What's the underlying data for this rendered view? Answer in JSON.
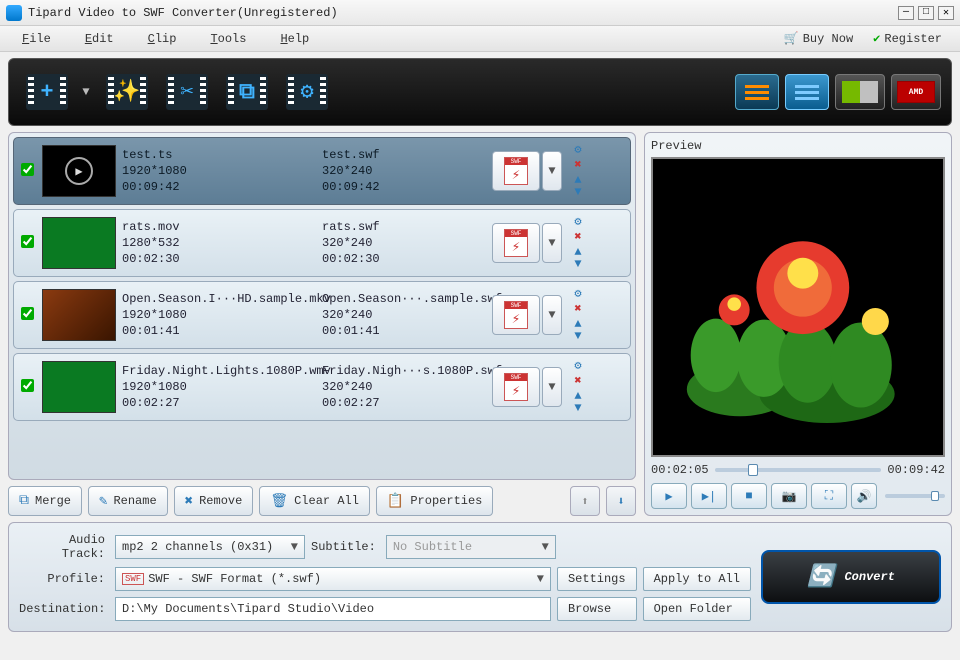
{
  "window": {
    "title": "Tipard Video to SWF Converter(Unregistered)"
  },
  "menu": {
    "file": "File",
    "edit": "Edit",
    "clip": "Clip",
    "tools": "Tools",
    "help": "Help",
    "buy": "Buy Now",
    "register": "Register"
  },
  "toolbar_icons": {
    "add": "+",
    "effect": "✨",
    "cut": "✂",
    "crop": "⧉",
    "settings": "⚙"
  },
  "preview": {
    "label": "Preview",
    "pos": "00:02:05",
    "dur": "00:09:42"
  },
  "rows": [
    {
      "selected": true,
      "src_name": "test.ts",
      "src_res": "1920*1080",
      "src_dur": "00:09:42",
      "out_name": "test.swf",
      "out_res": "320*240",
      "out_dur": "00:09:42",
      "thumb": "play"
    },
    {
      "selected": false,
      "src_name": "rats.mov",
      "src_res": "1280*532",
      "src_dur": "00:02:30",
      "out_name": "rats.swf",
      "out_res": "320*240",
      "out_dur": "00:02:30",
      "thumb": "green"
    },
    {
      "selected": false,
      "src_name": "Open.Season.I···HD.sample.mkv",
      "src_res": "1920*1080",
      "src_dur": "00:01:41",
      "out_name": "Open.Season···.sample.swf",
      "out_res": "320*240",
      "out_dur": "00:01:41",
      "thumb": "scene"
    },
    {
      "selected": false,
      "src_name": "Friday.Night.Lights.1080P.wmv",
      "src_res": "1920*1080",
      "src_dur": "00:02:27",
      "out_name": "Friday.Nigh···s.1080P.swf",
      "out_res": "320*240",
      "out_dur": "00:02:27",
      "thumb": "green"
    }
  ],
  "list_buttons": {
    "merge": "Merge",
    "rename": "Rename",
    "remove": "Remove",
    "clear": "Clear All",
    "properties": "Properties"
  },
  "form": {
    "audio_label": "Audio Track:",
    "audio_value": "mp2 2 channels (0x31)",
    "subtitle_label": "Subtitle:",
    "subtitle_value": "No Subtitle",
    "profile_label": "Profile:",
    "profile_value": "SWF - SWF Format (*.swf)",
    "dest_label": "Destination:",
    "dest_value": "D:\\My Documents\\Tipard Studio\\Video",
    "settings": "Settings",
    "apply": "Apply to All",
    "browse": "Browse",
    "open_folder": "Open Folder"
  },
  "convert": "Convert"
}
